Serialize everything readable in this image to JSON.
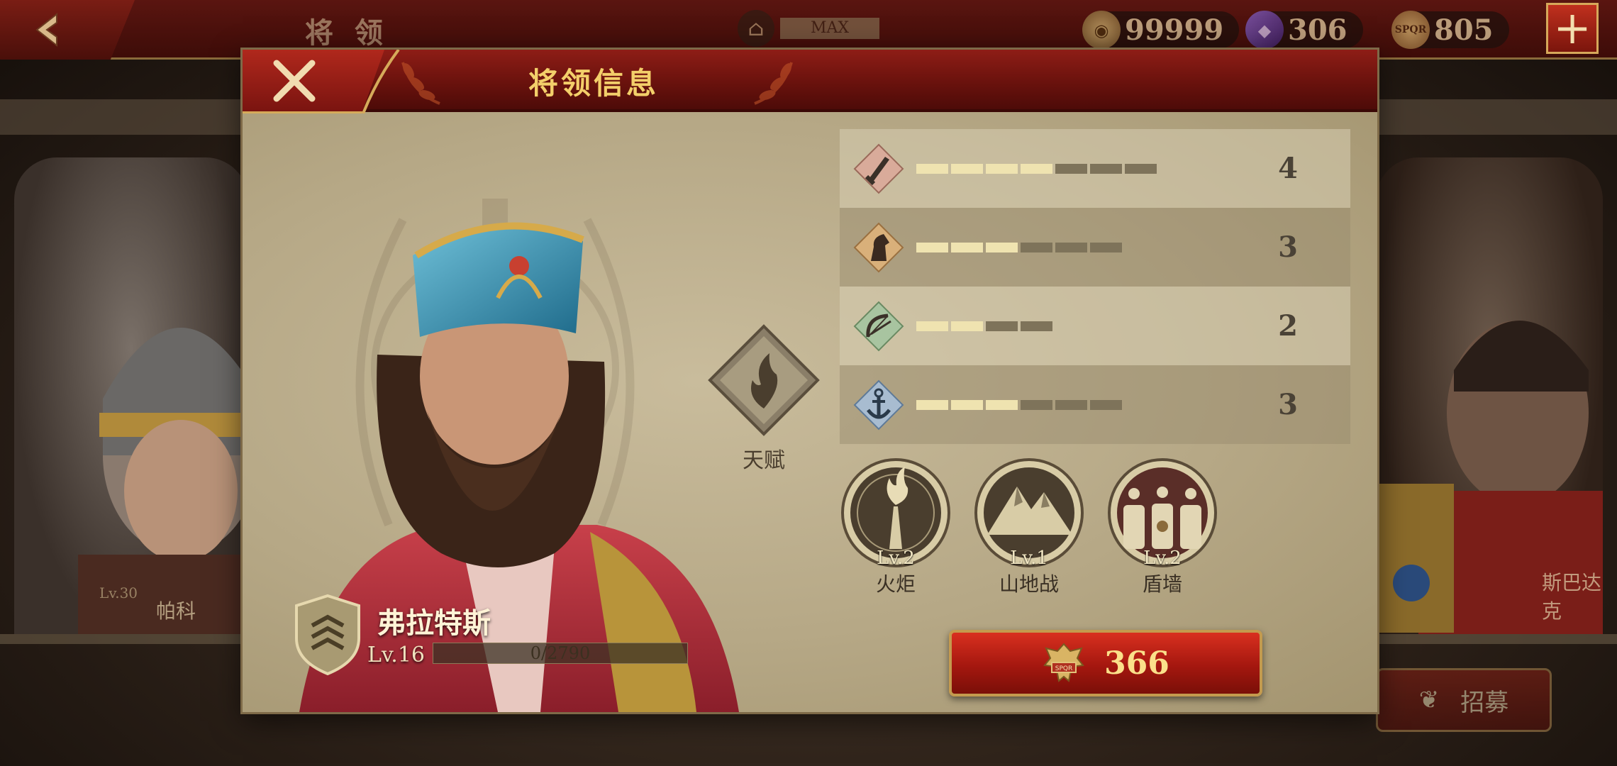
{
  "topbar": {
    "title": "将 领",
    "museum_label": "MAX",
    "coins": "99999",
    "gems": "306",
    "spqr": "805",
    "plus": "+"
  },
  "background": {
    "left_card_name": "帕科",
    "left_card_lv": "Lv.30",
    "right_card_name": "斯巴达克",
    "recruit_label": "招募"
  },
  "modal": {
    "title": "将领信息",
    "talent_label": "天赋",
    "hero": {
      "name": "弗拉特斯",
      "level": "Lv.16",
      "exp_text": "0/2790",
      "exp_fraction": 0
    },
    "stats": [
      {
        "icon": "sword-icon",
        "filled": 4,
        "max": 7,
        "value": "4"
      },
      {
        "icon": "horse-icon",
        "filled": 3,
        "max": 6,
        "value": "3"
      },
      {
        "icon": "bow-icon",
        "filled": 2,
        "max": 4,
        "value": "2"
      },
      {
        "icon": "anchor-icon",
        "filled": 3,
        "max": 6,
        "value": "3"
      }
    ],
    "skills": [
      {
        "icon": "torch-icon",
        "level": "Lv.2",
        "name": "火炬"
      },
      {
        "icon": "mountain-icon",
        "level": "Lv.1",
        "name": "山地战"
      },
      {
        "icon": "shield-wall-icon",
        "level": "Lv.2",
        "name": "盾墙"
      }
    ],
    "cost": "366"
  },
  "colors": {
    "header_red": "#8e1d16",
    "gold_text": "#f3cf6a",
    "parchment": "#b6a886",
    "button_red": "#c02418"
  }
}
